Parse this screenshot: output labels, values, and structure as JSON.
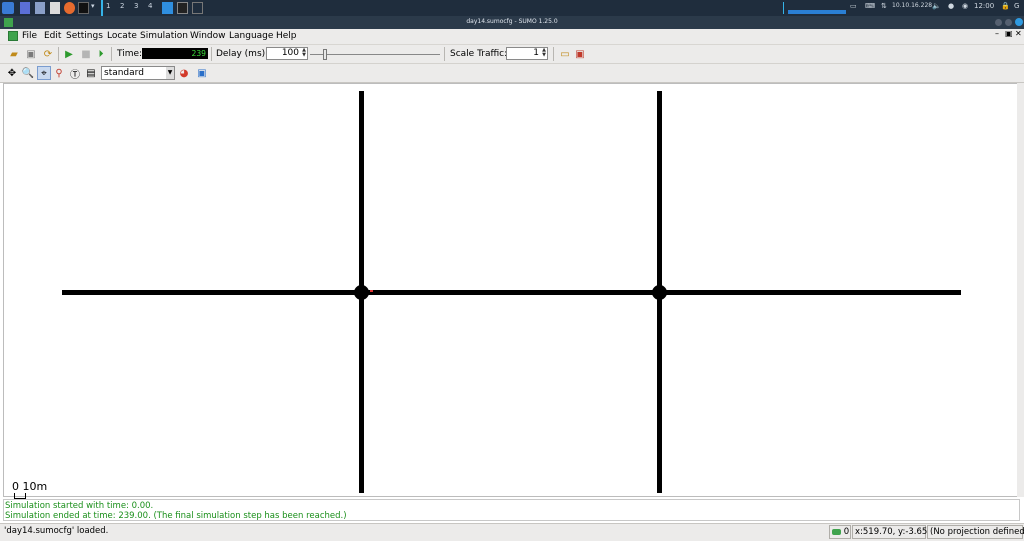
{
  "taskbar": {
    "workspaces": [
      "1",
      "2",
      "3",
      "4"
    ],
    "tray": {
      "ip": "10.10.16.228",
      "clock": "12:00"
    },
    "colors": {
      "background": "#1f2d3d",
      "graph": "#2a7fd4",
      "accent": "#35b3e8"
    }
  },
  "window": {
    "title": "day14.sumocfg - SUMO 1.25.0"
  },
  "menu": [
    "File",
    "Edit",
    "Settings",
    "Locate",
    "Simulation",
    "Window",
    "Language",
    "Help"
  ],
  "toolbar": {
    "time_label": "Time:",
    "time_value": "239",
    "delay_label": "Delay (ms):",
    "delay_value": "100",
    "scale_label": "Scale Traffic:",
    "scale_value": "1"
  },
  "view": {
    "scheme": "standard",
    "scale_legend": "0 10m"
  },
  "messages": [
    "Simulation started with time: 0.00.",
    "Simulation ended at time: 239.00. (The final simulation step has been reached.)"
  ],
  "status": {
    "message": "'day14.sumocfg' loaded.",
    "vehicles": "0",
    "coords": "x:519.70, y:-3.65",
    "projection": "(No projection defined)"
  },
  "colors": {
    "message_text": "#1a8f1a",
    "road": "#000000",
    "time_digits": "#39d839"
  }
}
